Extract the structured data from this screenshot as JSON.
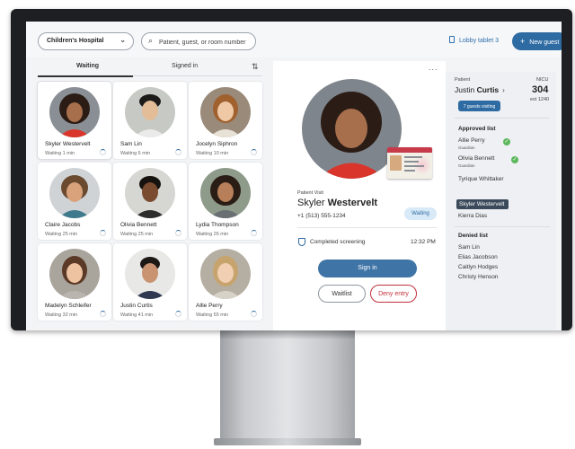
{
  "topbar": {
    "location_select": "Children's Hospital",
    "search_placeholder": "Patient, guest, or room number",
    "device_label": "Lobby tablet 3",
    "new_guest_label": "New guest"
  },
  "tabs": {
    "waiting": "Waiting",
    "signed_in": "Signed in"
  },
  "guests": [
    {
      "name": "Skyler Westervelt",
      "wait": "Waiting 1 min",
      "selected": true
    },
    {
      "name": "Sam Lin",
      "wait": "Waiting 6 min"
    },
    {
      "name": "Jocelyn Siphron",
      "wait": "Waiting 10 min"
    },
    {
      "name": "Claire Jacobs",
      "wait": "Waiting 25 min"
    },
    {
      "name": "Olivia Bennett",
      "wait": "Waiting 25 min"
    },
    {
      "name": "Lydia Thompson",
      "wait": "Waiting 26 min"
    },
    {
      "name": "Madelyn Schleifer",
      "wait": "Waiting 32 min"
    },
    {
      "name": "Justin Curtis",
      "wait": "Waiting 41 min"
    },
    {
      "name": "Allie Perry",
      "wait": "Waiting 55 min"
    }
  ],
  "visit": {
    "label": "Patient Visit",
    "first_name": "Skyler",
    "last_name": "Westervelt",
    "phone": "+1 (513) 555-1234",
    "status": "Waiting",
    "screening_label": "Completed screening",
    "screening_time": "12:32 PM",
    "sign_in_label": "Sign in",
    "waitlist_label": "Waitlist",
    "deny_label": "Deny entry",
    "more_label": "..."
  },
  "patient": {
    "label": "Patient",
    "unit": "NICU",
    "first_name": "Justin",
    "last_name": "Curtis",
    "room": "304",
    "ext": "ext 1240",
    "visiting": "7 guests visiting",
    "approved_title": "Approved list",
    "approved": [
      {
        "name": "Allie Perry",
        "role": "Guardian",
        "checked": true
      },
      {
        "name": "Olivia Bennett",
        "role": "Guardian",
        "checked": true
      },
      {
        "name": "Tyrique Whittaker"
      },
      {
        "name": "Skyler Westervelt",
        "highlight": true
      },
      {
        "name": "Kierra Dias"
      }
    ],
    "denied_title": "Denied list",
    "denied": [
      "Sam Lin",
      "Elias Jacobson",
      "Caitlyn Hodges",
      "Christy Henson"
    ]
  },
  "colors": {
    "accent": "#2e6ba3",
    "deny": "#c0303c",
    "check": "#5cb85c"
  },
  "icons": [
    "chevron-down-icon",
    "search-icon",
    "tablet-icon",
    "plus-icon",
    "sort-icon",
    "more-icon",
    "shield-icon",
    "chevron-right-icon",
    "check-icon",
    "spinner-icon"
  ]
}
